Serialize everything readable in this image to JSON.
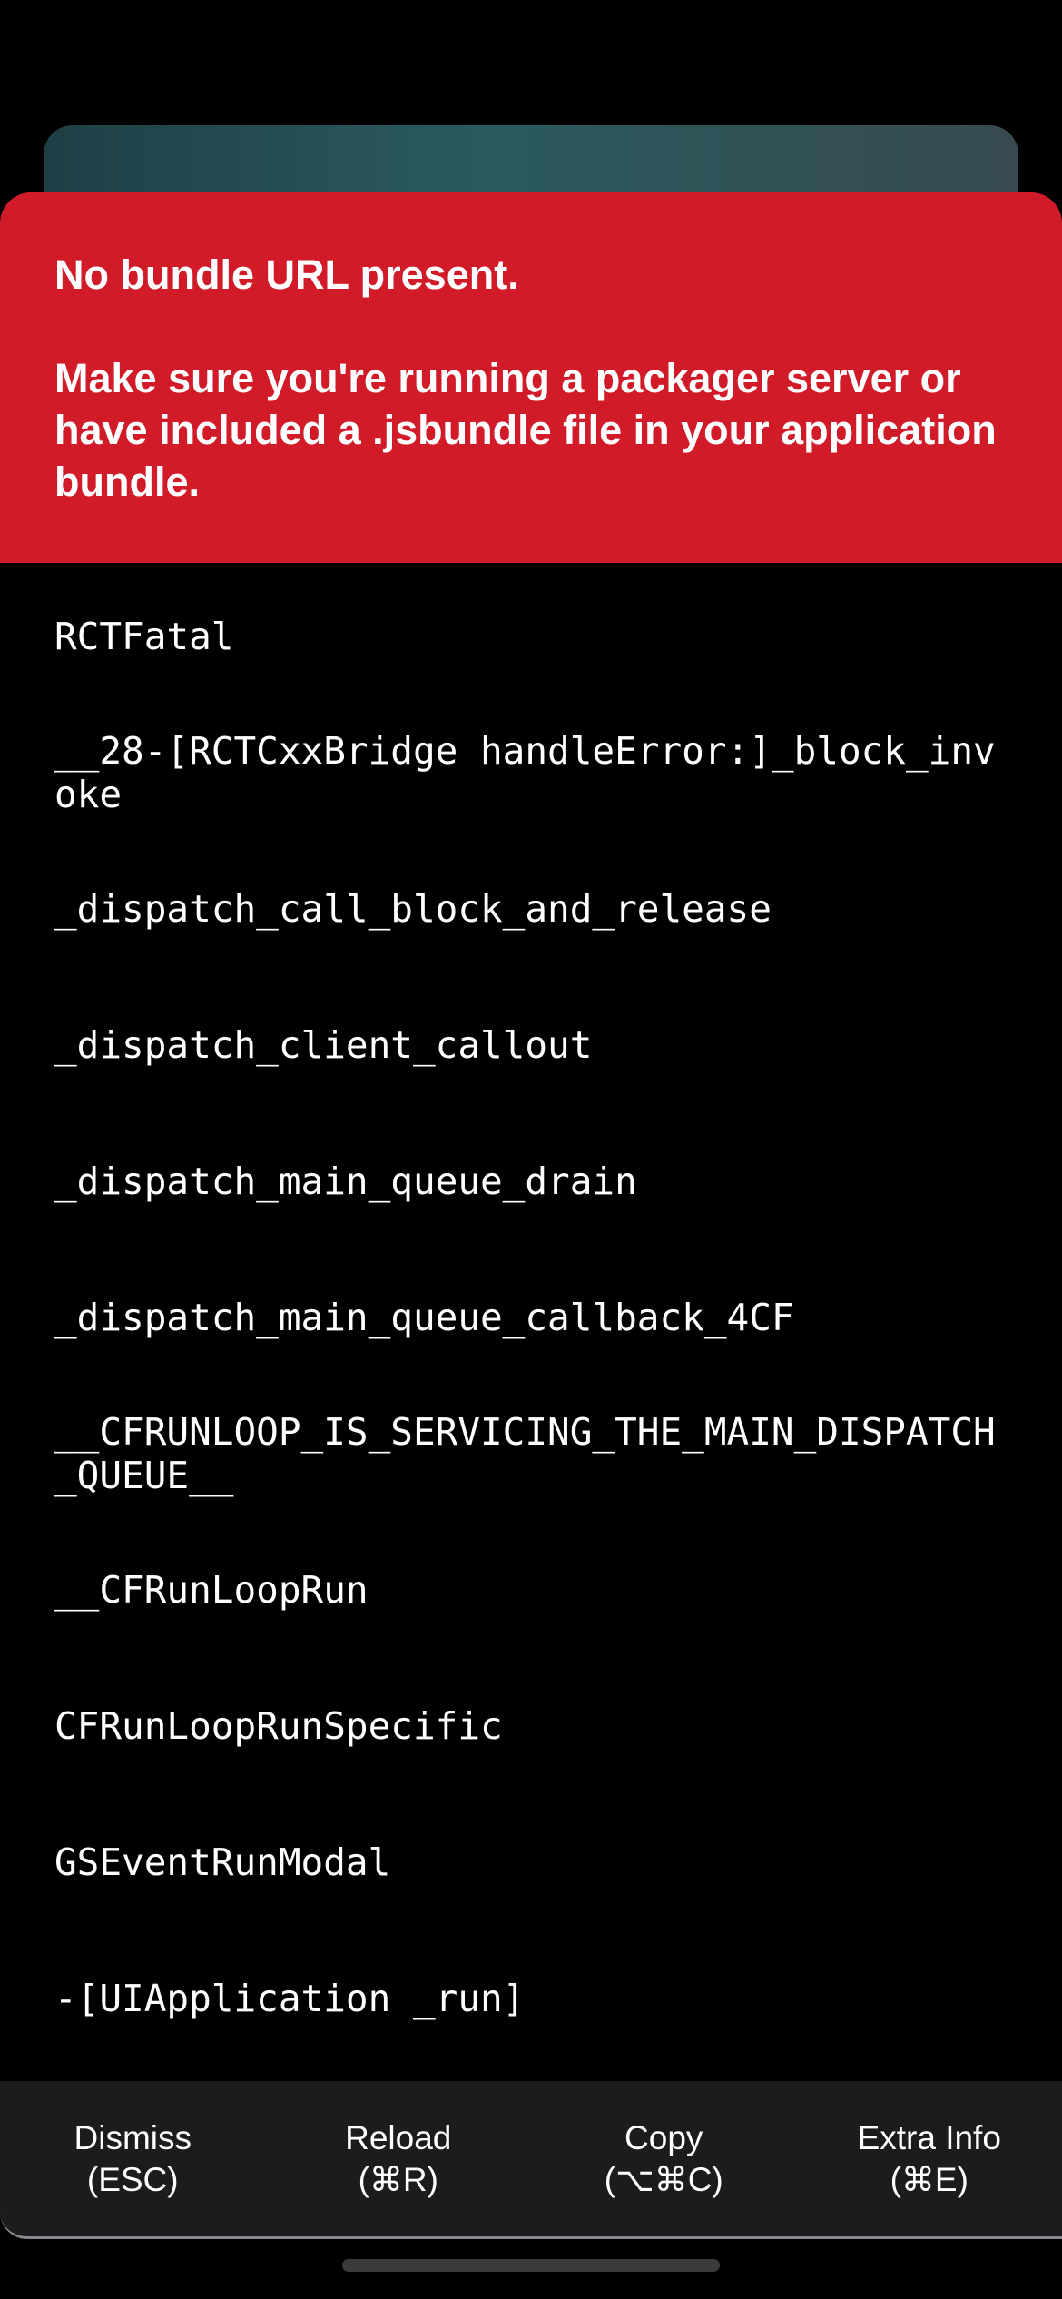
{
  "error": {
    "title": "No bundle URL present.",
    "message": "Make sure you're running a packager server or have included a .jsbundle file in your application bundle."
  },
  "stack_frames": [
    "RCTFatal",
    "__28-[RCTCxxBridge handleError:]_block_invoke",
    "_dispatch_call_block_and_release",
    "_dispatch_client_callout",
    "_dispatch_main_queue_drain",
    "_dispatch_main_queue_callback_4CF",
    "__CFRUNLOOP_IS_SERVICING_THE_MAIN_DISPATCH_QUEUE__",
    "__CFRunLoopRun",
    "CFRunLoopRunSpecific",
    "GSEventRunModal",
    "-[UIApplication _run]"
  ],
  "footer": {
    "dismiss": {
      "label": "Dismiss",
      "shortcut": "(ESC)"
    },
    "reload": {
      "label": "Reload",
      "shortcut": "(⌘R)"
    },
    "copy": {
      "label": "Copy",
      "shortcut": "(⌥⌘C)"
    },
    "extra_info": {
      "label": "Extra Info",
      "shortcut": "(⌘E)"
    }
  },
  "colors": {
    "banner": "#d11b28",
    "background": "#000000",
    "footer": "#1c1c1e",
    "text": "#ffffff"
  }
}
